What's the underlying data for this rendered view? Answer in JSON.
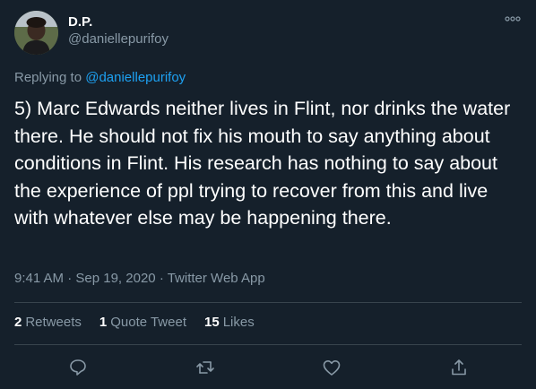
{
  "author": {
    "display_name": "D.P.",
    "handle": "@daniellepurifoy"
  },
  "reply": {
    "prefix": "Replying to",
    "mention": "@daniellepurifoy"
  },
  "tweet": {
    "text": "5) Marc Edwards neither lives in Flint, nor drinks the water there. He should not fix his mouth to say anything about conditions in Flint. His research has nothing to say about the experience of ppl trying to recover from this and live with whatever else may be happening there.",
    "time": "9:41 AM",
    "separator": "·",
    "date": "Sep 19, 2020",
    "source": "Twitter Web App"
  },
  "stats": {
    "retweets_count": "2",
    "retweets_label": "Retweets",
    "quotes_count": "1",
    "quotes_label": "Quote Tweet",
    "likes_count": "15",
    "likes_label": "Likes"
  },
  "actions": {
    "reply_icon": "reply-icon",
    "retweet_icon": "retweet-icon",
    "like_icon": "like-icon",
    "share_icon": "share-icon"
  },
  "colors": {
    "background": "#15202b",
    "text": "#ffffff",
    "secondary": "#8899a6",
    "accent": "#1da1f2",
    "divider": "#38444d"
  }
}
